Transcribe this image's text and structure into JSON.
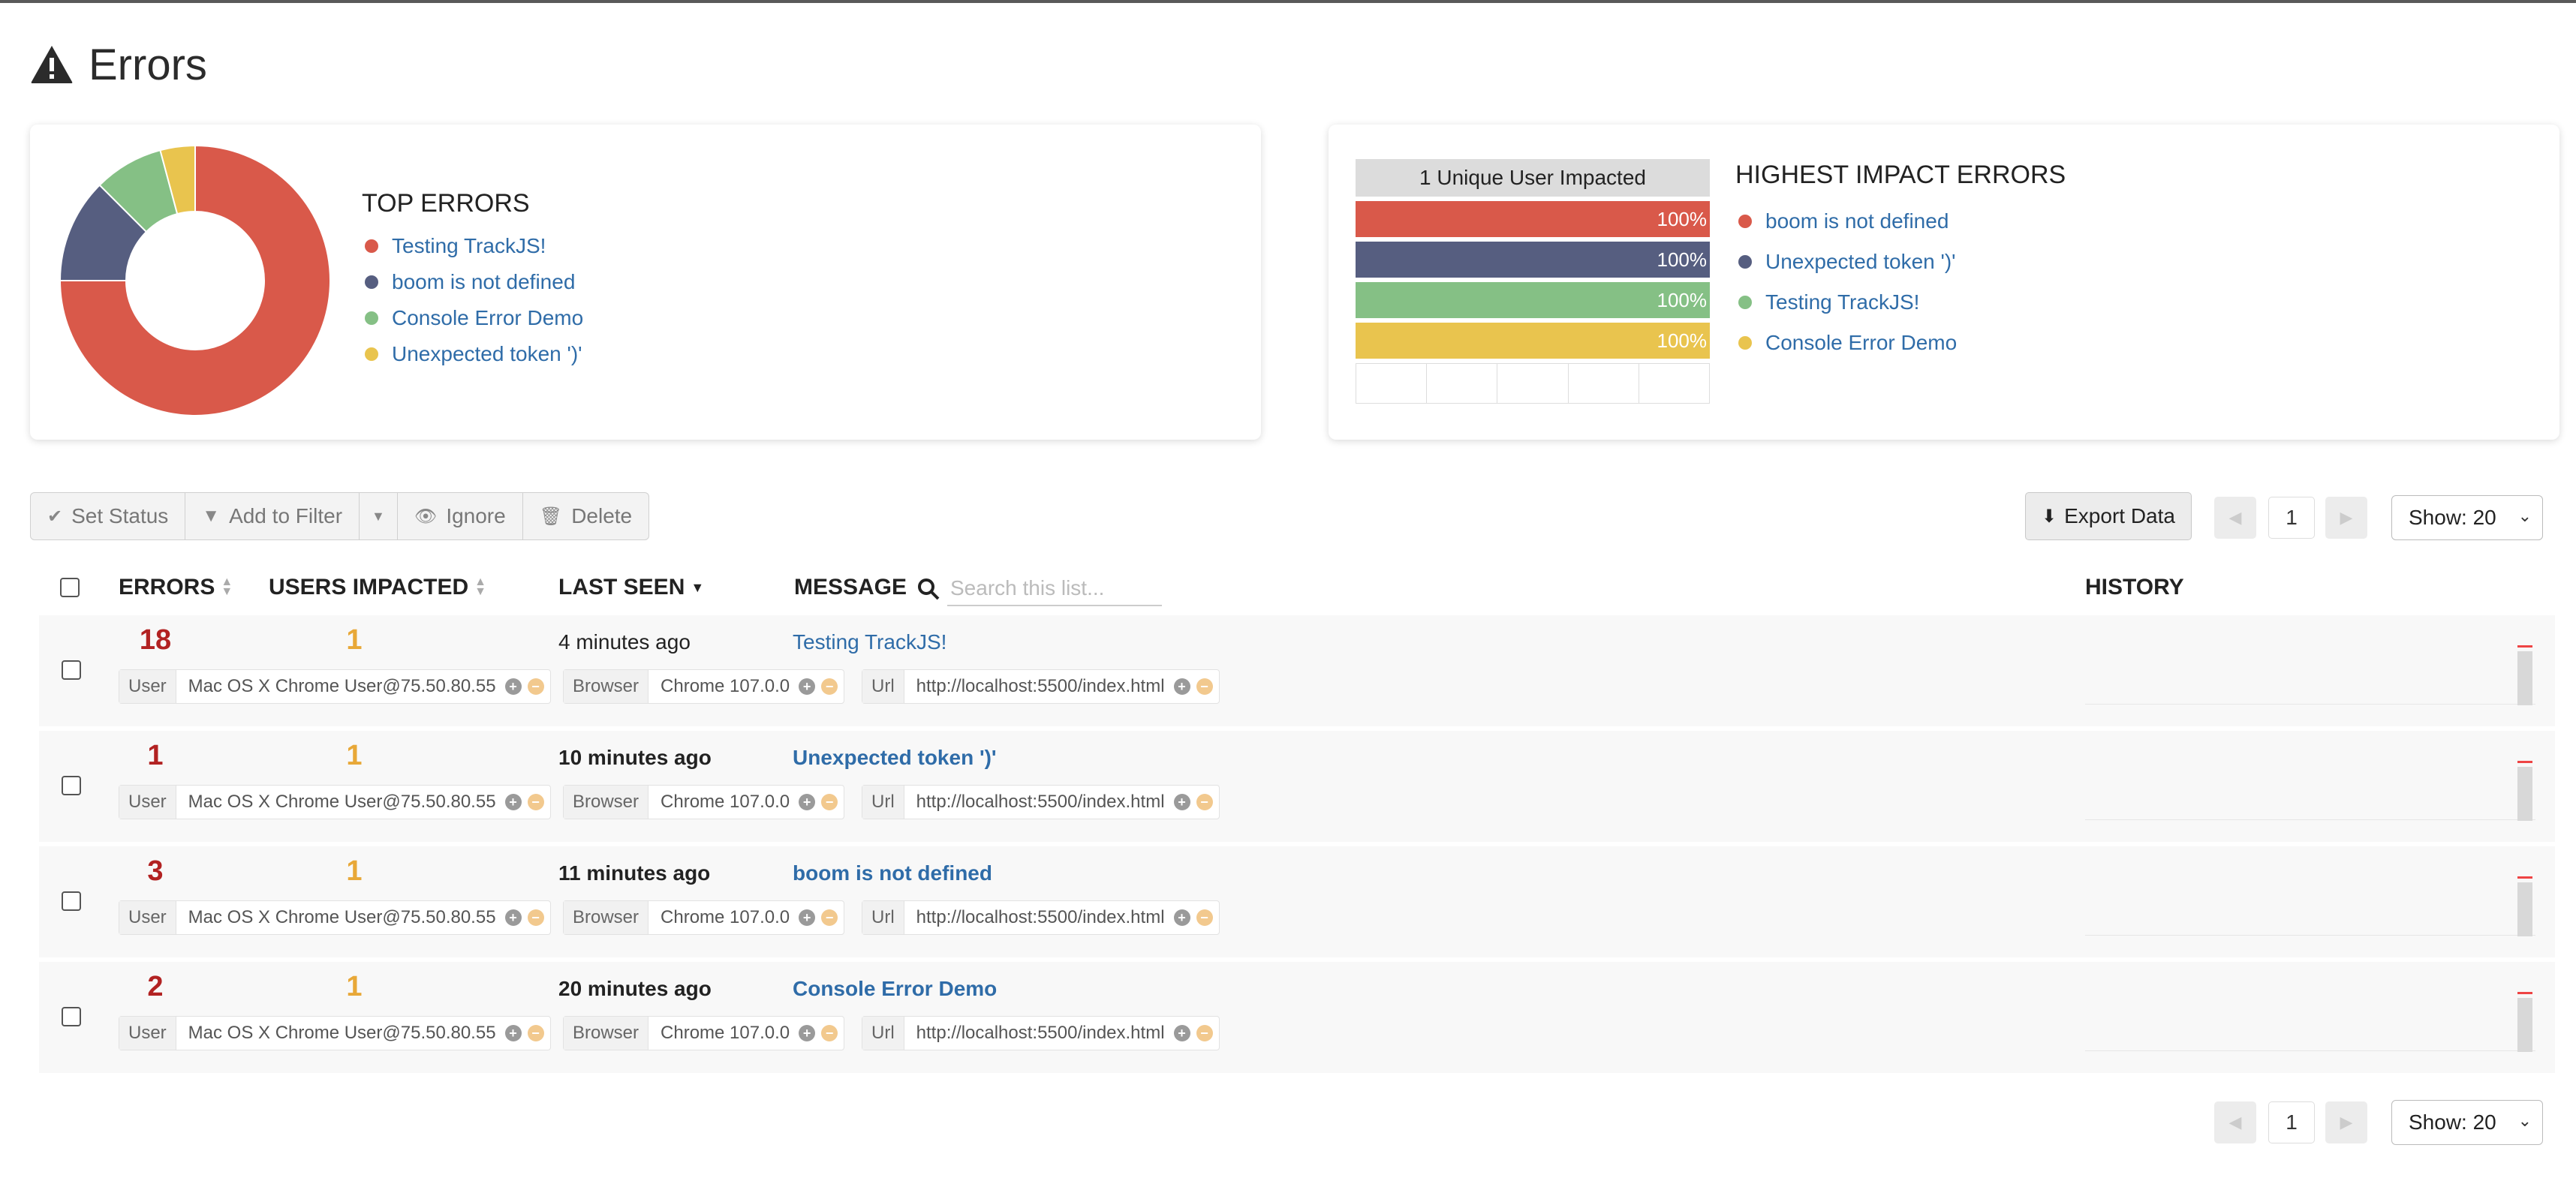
{
  "header": {
    "title": "Errors"
  },
  "top_errors": {
    "heading": "TOP ERRORS",
    "chart_data": {
      "type": "pie",
      "categories": [
        "Testing TrackJS!",
        "boom is not defined",
        "Console Error Demo",
        "Unexpected token ')'"
      ],
      "values": [
        18,
        3,
        2,
        1
      ],
      "colors": [
        "#d9594a",
        "#565e80",
        "#85c085",
        "#e9c44e"
      ]
    },
    "legend": [
      {
        "label": "Testing TrackJS!",
        "color": "#d9594a"
      },
      {
        "label": "boom is not defined",
        "color": "#565e80"
      },
      {
        "label": "Console Error Demo",
        "color": "#85c085"
      },
      {
        "label": "Unexpected token ')'",
        "color": "#e9c44e"
      }
    ]
  },
  "impact": {
    "heading": "HIGHEST IMPACT ERRORS",
    "chart_header": "1 Unique User Impacted",
    "chart_data": {
      "type": "bar",
      "categories": [
        "boom is not defined",
        "Unexpected token ')'",
        "Testing TrackJS!",
        "Console Error Demo"
      ],
      "values": [
        100,
        100,
        100,
        100
      ],
      "labels": [
        "100%",
        "100%",
        "100%",
        "100%"
      ],
      "colors": [
        "#d9594a",
        "#565e80",
        "#85c085",
        "#e9c44e"
      ]
    },
    "legend": [
      {
        "label": "boom is not defined",
        "color": "#d9594a"
      },
      {
        "label": "Unexpected token ')'",
        "color": "#565e80"
      },
      {
        "label": "Testing TrackJS!",
        "color": "#85c085"
      },
      {
        "label": "Console Error Demo",
        "color": "#e9c44e"
      }
    ]
  },
  "toolbar": {
    "set_status": "Set Status",
    "add_to_filter": "Add to Filter",
    "ignore": "Ignore",
    "delete": "Delete",
    "export": "Export Data",
    "page": "1",
    "show": "Show: 20"
  },
  "table": {
    "col_errors": "ERRORS",
    "col_users": "USERS IMPACTED",
    "col_last_seen": "LAST SEEN",
    "col_message": "MESSAGE",
    "search_placeholder": "Search this list...",
    "col_history": "HISTORY",
    "rows": [
      {
        "errors": "18",
        "users": "1",
        "last_seen": "4 minutes ago",
        "message": "Testing TrackJS!",
        "user_key": "User",
        "user_val": "Mac OS X Chrome User@75.50.80.55",
        "browser_key": "Browser",
        "browser_val": "Chrome 107.0.0",
        "url_key": "Url",
        "url_val": "http://localhost:5500/index.html"
      },
      {
        "errors": "1",
        "users": "1",
        "last_seen": "10 minutes ago",
        "message": "Unexpected token ')'",
        "user_key": "User",
        "user_val": "Mac OS X Chrome User@75.50.80.55",
        "browser_key": "Browser",
        "browser_val": "Chrome 107.0.0",
        "url_key": "Url",
        "url_val": "http://localhost:5500/index.html"
      },
      {
        "errors": "3",
        "users": "1",
        "last_seen": "11 minutes ago",
        "message": "boom is not defined",
        "user_key": "User",
        "user_val": "Mac OS X Chrome User@75.50.80.55",
        "browser_key": "Browser",
        "browser_val": "Chrome 107.0.0",
        "url_key": "Url",
        "url_val": "http://localhost:5500/index.html"
      },
      {
        "errors": "2",
        "users": "1",
        "last_seen": "20 minutes ago",
        "message": "Console Error Demo",
        "user_key": "User",
        "user_val": "Mac OS X Chrome User@75.50.80.55",
        "browser_key": "Browser",
        "browser_val": "Chrome 107.0.0",
        "url_key": "Url",
        "url_val": "http://localhost:5500/index.html"
      }
    ]
  },
  "footer": {
    "page": "1",
    "show": "Show: 20"
  }
}
